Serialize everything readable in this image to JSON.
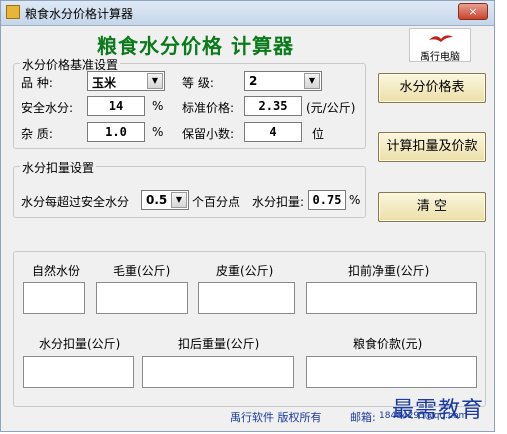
{
  "window": {
    "title": "粮食水分价格计算器",
    "close_label": "×"
  },
  "heading": "粮食水分价格 计算器",
  "logo": {
    "text": "禹行电脑"
  },
  "base_group": {
    "title": "水分价格基准设置",
    "variety_label": "品    种:",
    "variety_value": "玉米",
    "grade_label": "等    级:",
    "grade_value": "2",
    "safe_moisture_label": "安全水分:",
    "safe_moisture_value": "14",
    "safe_moisture_unit": "%",
    "standard_price_label": "标准价格:",
    "standard_price_value": "2.35",
    "standard_price_unit": "(元/公斤)",
    "impurity_label": "杂    质:",
    "impurity_value": "1.0",
    "impurity_unit": "%",
    "decimals_label": "保留小数:",
    "decimals_value": "4",
    "decimals_unit": "位"
  },
  "deduct_group": {
    "title": "水分扣量设置",
    "per_label": "水分每超过安全水分",
    "per_value": "0.5",
    "per_unit": "个百分点",
    "deduct_label": "水分扣量:",
    "deduct_value": "0.75",
    "deduct_unit": "%"
  },
  "buttons": {
    "price_table": "水分价格表",
    "calculate": "计算扣量及价款",
    "clear": "清      空"
  },
  "results": {
    "natural_moisture": "自然水份",
    "gross_weight": "毛重(公斤)",
    "tare_weight": "皮重(公斤)",
    "net_before": "扣前净重(公斤)",
    "moisture_deduct": "水分扣量(公斤)",
    "weight_after": "扣后重量(公斤)",
    "grain_payment": "粮食价款(元)"
  },
  "footer": {
    "copyright": "禹行软件  版权所有",
    "email_label": "邮箱:",
    "email_value": "18484295@qq.com"
  },
  "watermark": "最需教育"
}
